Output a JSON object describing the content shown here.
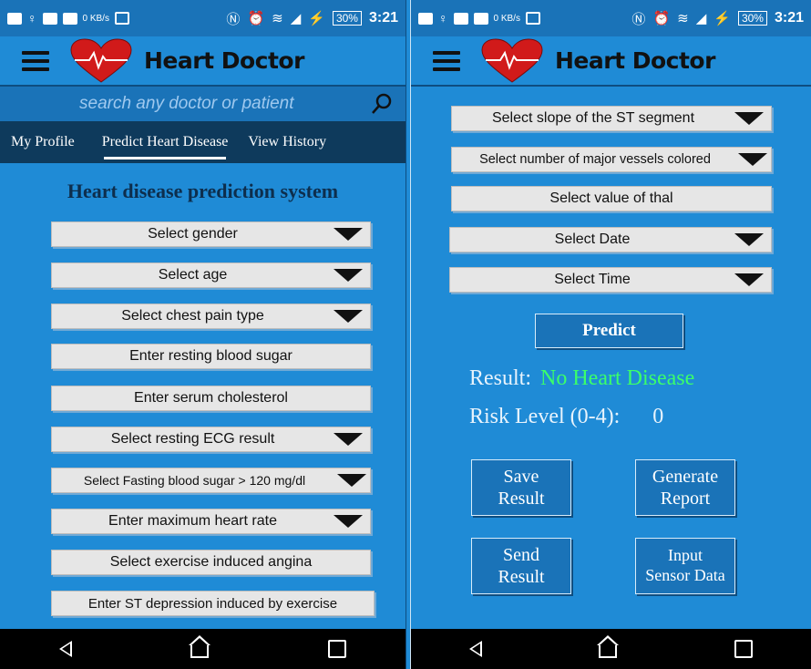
{
  "status": {
    "time": "3:21",
    "battery": "30%",
    "kb_label": "0 KB/s"
  },
  "app": {
    "title": "Heart Doctor"
  },
  "search": {
    "placeholder": "search any doctor or patient"
  },
  "tabs": [
    {
      "label": "My Profile"
    },
    {
      "label": "Predict Heart Disease"
    },
    {
      "label": "View History"
    }
  ],
  "form": {
    "heading": "Heart disease prediction system",
    "fields": [
      {
        "label": "Select gender",
        "type": "dropdown"
      },
      {
        "label": "Select age",
        "type": "dropdown"
      },
      {
        "label": "Select chest pain type",
        "type": "dropdown"
      },
      {
        "label": "Enter resting blood sugar",
        "type": "input"
      },
      {
        "label": "Enter serum cholesterol",
        "type": "input"
      },
      {
        "label": "Select resting ECG result",
        "type": "dropdown"
      },
      {
        "label": "Select Fasting blood sugar > 120 mg/dl",
        "type": "dropdown"
      },
      {
        "label": "Enter maximum heart rate",
        "type": "dropdown"
      },
      {
        "label": "Select exercise induced angina",
        "type": "input"
      },
      {
        "label": "Enter ST depression induced by exercise",
        "type": "input"
      }
    ],
    "fields_right": [
      {
        "label": "Select slope of the ST segment",
        "type": "dropdown"
      },
      {
        "label": "Select number of major vessels colored",
        "type": "dropdown"
      },
      {
        "label": "Select value of thal",
        "type": "input"
      },
      {
        "label": "Select Date",
        "type": "dropdown"
      },
      {
        "label": "Select Time",
        "type": "dropdown"
      }
    ]
  },
  "predict": {
    "button_label": "Predict",
    "result_label": "Result:",
    "result_value": "No Heart Disease",
    "risk_label": "Risk Level (0-4):",
    "risk_value": "0"
  },
  "actions": {
    "save": "Save\nResult",
    "generate": "Generate\nReport",
    "send": "Send\nResult",
    "input_sensor": "Input\nSensor Data"
  },
  "colors": {
    "background": "#1f8bd6",
    "result_value": "#3bff6a",
    "tab_bar": "#0e3a5c"
  }
}
